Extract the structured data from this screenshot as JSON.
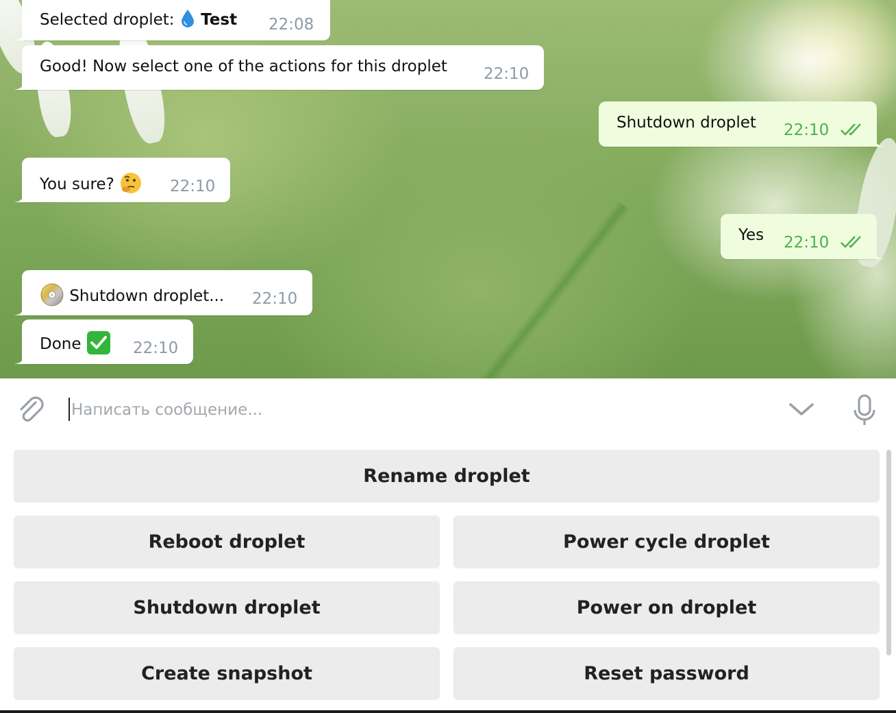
{
  "messages": [
    {
      "dir": "in",
      "text_prefix": "Selected droplet:",
      "emoji": "droplet",
      "text_bold": "Test",
      "time": "22:08"
    },
    {
      "dir": "in",
      "text": "Good! Now select one of the actions for this droplet",
      "time": "22:10"
    },
    {
      "dir": "out",
      "text": "Shutdown droplet",
      "time": "22:10",
      "status": "read"
    },
    {
      "dir": "in",
      "text": "You sure?",
      "emoji": "thinking-face",
      "time": "22:10"
    },
    {
      "dir": "out",
      "text": "Yes",
      "time": "22:10",
      "status": "read"
    },
    {
      "dir": "in",
      "emoji": "dvd",
      "text": "Shutdown droplet...",
      "time": "22:10"
    },
    {
      "dir": "in",
      "text": "Done",
      "emoji": "check-mark-button",
      "time": "22:10"
    }
  ],
  "input": {
    "placeholder": "Написать сообщение..."
  },
  "keyboard": {
    "rename": "Rename droplet",
    "reboot": "Reboot droplet",
    "power_cycle": "Power cycle droplet",
    "shutdown": "Shutdown droplet",
    "power_on": "Power on droplet",
    "snapshot": "Create snapshot",
    "reset_password": "Reset password"
  },
  "icons": {
    "attach": "paperclip-icon",
    "collapse": "chevron-down-icon",
    "voice": "microphone-icon",
    "read_status": "double-check-icon"
  },
  "colors": {
    "incoming_bubble": "#ffffff",
    "outgoing_bubble": "#effdde",
    "outgoing_time": "#4fae4e",
    "incoming_time": "#8d9aa6",
    "keyboard_button": "#ececec"
  }
}
